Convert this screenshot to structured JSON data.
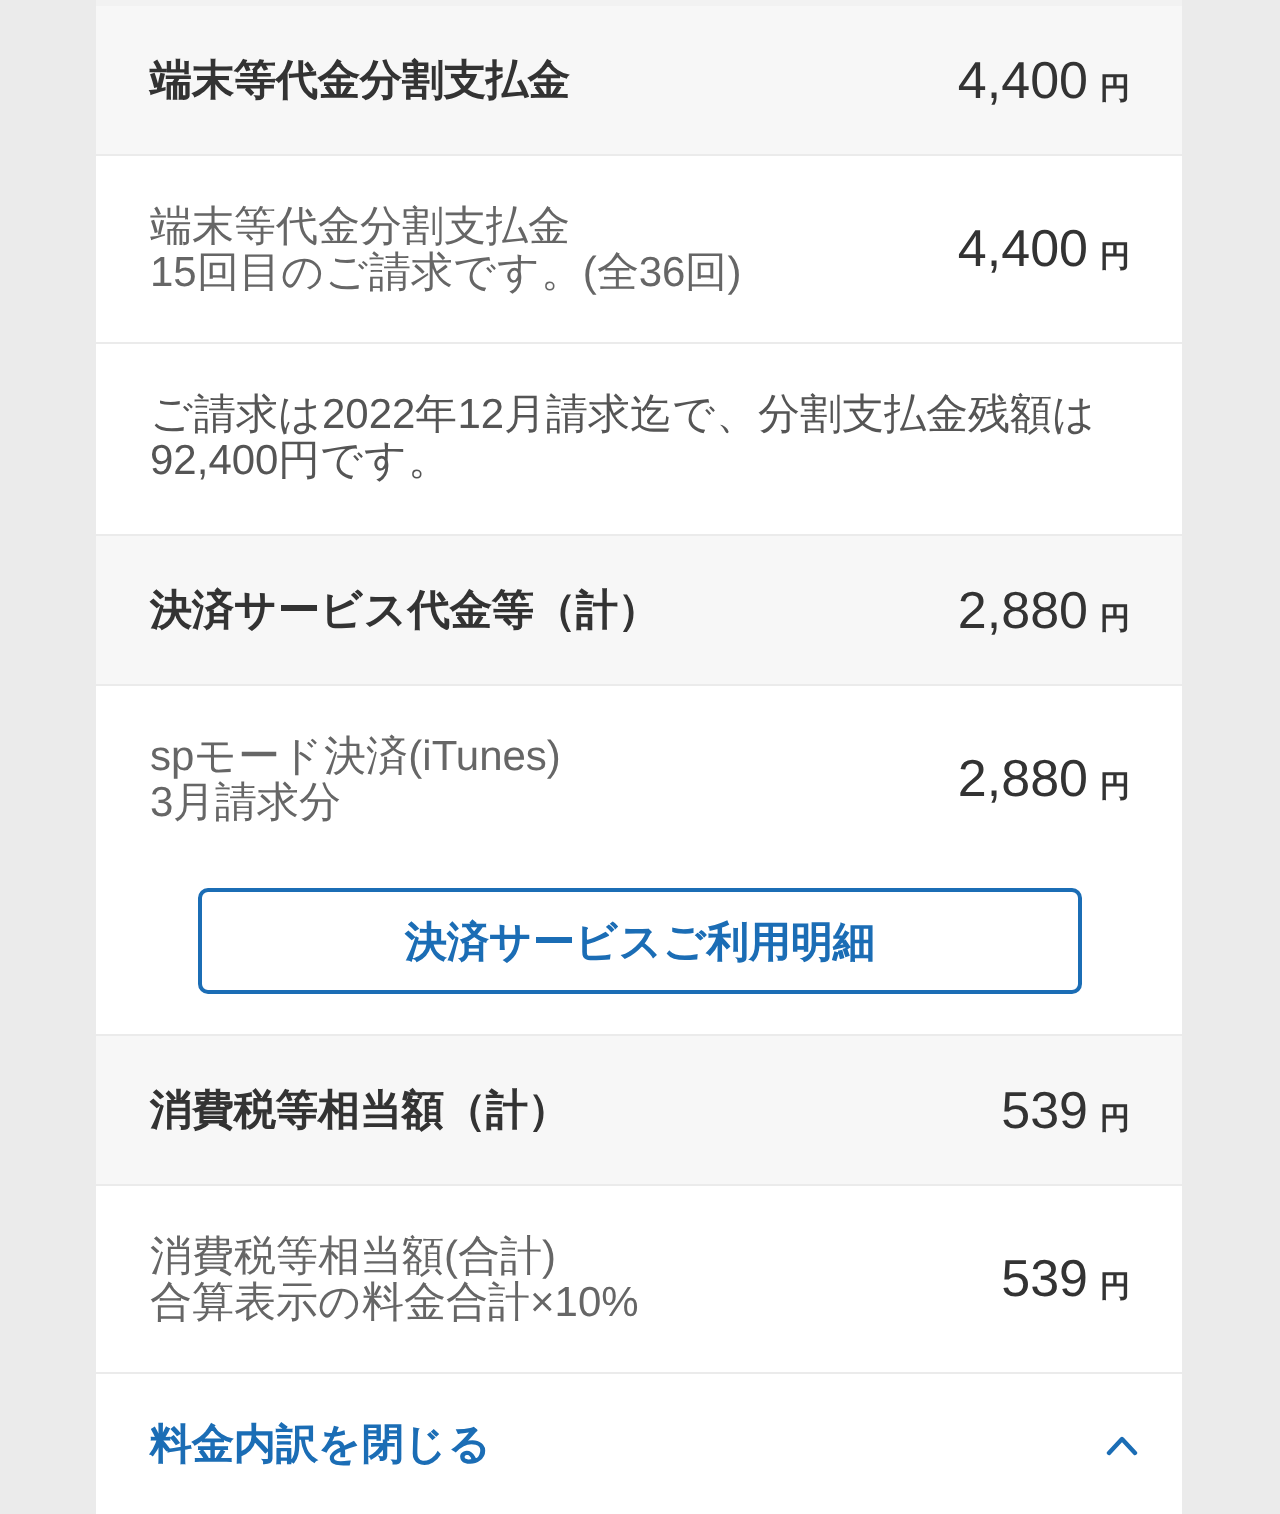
{
  "sections": [
    {
      "title": "端末等代金分割支払金",
      "amount": "4,400",
      "unit": "円",
      "items": [
        {
          "kind": "charge",
          "name": "端末等代金分割支払金",
          "note": "15回目のご請求です。(全36回)",
          "amount": "4,400",
          "unit": "円"
        },
        {
          "kind": "note",
          "text": "ご請求は2022年12月請求迄で、分割支払金残額は92,400円です。"
        }
      ]
    },
    {
      "title": "決済サービス代金等（計）",
      "amount": "2,880",
      "unit": "円",
      "items": [
        {
          "kind": "charge",
          "name": "spモード決済(iTunes)",
          "note": "3月請求分",
          "amount": "2,880",
          "unit": "円"
        },
        {
          "kind": "button",
          "label": "決済サービスご利用明細"
        }
      ]
    },
    {
      "title": "消費税等相当額（計）",
      "amount": "539",
      "unit": "円",
      "items": [
        {
          "kind": "charge",
          "name": "消費税等相当額(合計)",
          "note": "合算表示の料金合計×10%",
          "amount": "539",
          "unit": "円"
        }
      ]
    }
  ],
  "footer": {
    "link": "料金内訳を閉じる",
    "expanded": true
  }
}
